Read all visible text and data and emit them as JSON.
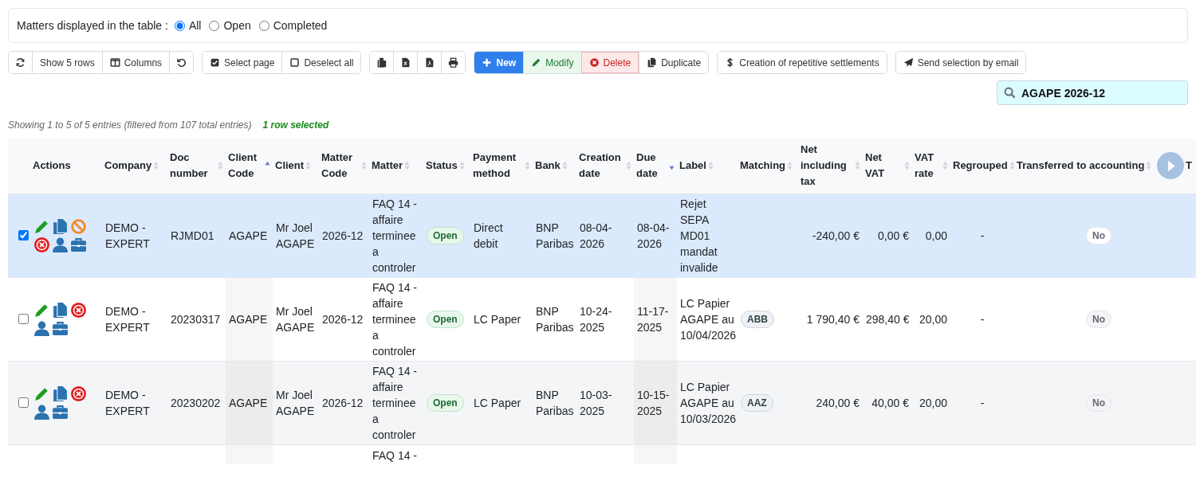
{
  "filter": {
    "label": "Matters displayed in the table :",
    "options": [
      {
        "label": "All",
        "selected": true
      },
      {
        "label": "Open",
        "selected": false
      },
      {
        "label": "Completed",
        "selected": false
      }
    ]
  },
  "toolbar": [
    {
      "buttons": [
        {
          "kind": "icon"
        },
        {
          "label": "Show 5 rows",
          "kind": "plain"
        },
        {
          "label": "Columns",
          "kind": "plain"
        },
        {
          "kind": "icon"
        }
      ]
    },
    {
      "buttons": [
        {
          "label": "Select page",
          "kind": "plain"
        },
        {
          "label": "Deselect all",
          "kind": "plain"
        }
      ]
    },
    {
      "buttons": [
        {
          "kind": "icon"
        },
        {
          "kind": "icon"
        },
        {
          "kind": "icon"
        },
        {
          "kind": "icon"
        }
      ]
    },
    {
      "buttons": [
        {
          "label": "New",
          "kind": "primary"
        },
        {
          "label": "Modify",
          "kind": "success"
        },
        {
          "label": "Delete",
          "kind": "danger"
        },
        {
          "label": "Duplicate",
          "kind": "plain"
        }
      ]
    },
    {
      "buttons": [
        {
          "label": "Creation of repetitive settlements",
          "kind": "plain"
        }
      ]
    },
    {
      "buttons": [
        {
          "label": "Send selection by email",
          "kind": "plain"
        }
      ]
    }
  ],
  "search": {
    "value": "AGAPE 2026-12"
  },
  "info": {
    "text": "Showing 1 to 5 of 5 entries (filtered from 107 total entries)",
    "selection": "1 row selected"
  },
  "table": {
    "columns": [
      {
        "label": "Actions",
        "sortable": false
      },
      {
        "label": "Company",
        "sortable": true,
        "sort_asc": false,
        "sort_desc": false
      },
      {
        "label": "Doc number",
        "sortable": true,
        "sort_asc": false,
        "sort_desc": false
      },
      {
        "label": "Client Code",
        "sortable": true,
        "sort_asc": true,
        "sort_desc": false
      },
      {
        "label": "Client",
        "sortable": true,
        "sort_asc": false,
        "sort_desc": false
      },
      {
        "label": "Matter Code",
        "sortable": true,
        "sort_asc": false,
        "sort_desc": false
      },
      {
        "label": "Matter",
        "sortable": true,
        "sort_asc": false,
        "sort_desc": false
      },
      {
        "label": "Status",
        "sortable": true,
        "sort_asc": false,
        "sort_desc": false
      },
      {
        "label": "Payment method",
        "sortable": true,
        "sort_asc": false,
        "sort_desc": false
      },
      {
        "label": "Bank",
        "sortable": true,
        "sort_asc": false,
        "sort_desc": false
      },
      {
        "label": "Creation date",
        "sortable": true,
        "sort_asc": false,
        "sort_desc": false
      },
      {
        "label": "Due date",
        "sortable": true,
        "sort_asc": false,
        "sort_desc": true
      },
      {
        "label": "Label",
        "sortable": true,
        "sort_asc": false,
        "sort_desc": false
      },
      {
        "label": "Matching",
        "sortable": true,
        "sort_asc": false,
        "sort_desc": false
      },
      {
        "label": "Net including tax",
        "sortable": true,
        "sort_asc": false,
        "sort_desc": false
      },
      {
        "label": "Net VAT",
        "sortable": true,
        "sort_asc": false,
        "sort_desc": false
      },
      {
        "label": "VAT rate",
        "sortable": true,
        "sort_asc": false,
        "sort_desc": false
      },
      {
        "label": "Regrouped",
        "sortable": true,
        "sort_asc": false,
        "sort_desc": false
      },
      {
        "label": "Transferred to accounting",
        "sortable": true,
        "sort_asc": false,
        "sort_desc": false
      },
      {
        "label": "T"
      }
    ],
    "rows": [
      {
        "selected": true,
        "actions": [
          {
            "kind": "edit"
          },
          {
            "kind": "copy"
          },
          {
            "kind": "ban"
          },
          {
            "kind": "delete"
          },
          {
            "kind": "client"
          },
          {
            "kind": "briefcase"
          }
        ],
        "company": "DEMO - EXPERT",
        "doc_number": "RJMD01",
        "client_code": "AGAPE",
        "client": "Mr Joel AGAPE",
        "matter_code": "2026-12",
        "matter": "FAQ 14 - affaire terminee a controler",
        "status": "Open",
        "payment_method": "Direct debit",
        "bank": "BNP Paribas",
        "creation_date": "08-04-2026",
        "due_date": "08-04-2026",
        "label": "Rejet SEPA MD01 mandat invalide",
        "net_including_tax": "-240,00 €",
        "net_vat": "0,00 €",
        "vat_rate": "0,00",
        "regrouped": "-",
        "transferred": "No"
      },
      {
        "selected": false,
        "actions": [
          {
            "kind": "edit"
          },
          {
            "kind": "copy"
          },
          {
            "kind": "delete"
          },
          {
            "kind": "client"
          },
          {
            "kind": "briefcase"
          }
        ],
        "company": "DEMO - EXPERT",
        "doc_number": "20230317",
        "client_code": "AGAPE",
        "client": "Mr Joel AGAPE",
        "matter_code": "2026-12",
        "matter": "FAQ 14 - affaire terminee a controler",
        "status": "Open",
        "payment_method": "LC Paper",
        "bank": "BNP Paribas",
        "creation_date": "10-24-2025",
        "due_date": "11-17-2025",
        "label": "LC Papier AGAPE au 10/04/2026",
        "matching": "ABB",
        "net_including_tax": "1 790,40 €",
        "net_vat": "298,40 €",
        "vat_rate": "20,00",
        "regrouped": "-",
        "transferred": "No"
      },
      {
        "selected": false,
        "actions": [
          {
            "kind": "edit"
          },
          {
            "kind": "copy"
          },
          {
            "kind": "delete"
          },
          {
            "kind": "client"
          },
          {
            "kind": "briefcase"
          }
        ],
        "company": "DEMO - EXPERT",
        "doc_number": "20230202",
        "client_code": "AGAPE",
        "client": "Mr Joel AGAPE",
        "matter_code": "2026-12",
        "matter": "FAQ 14 - affaire terminee a controler",
        "status": "Open",
        "payment_method": "LC Paper",
        "bank": "BNP Paribas",
        "creation_date": "10-03-2025",
        "due_date": "10-15-2025",
        "label": "LC Papier AGAPE au 10/03/2026",
        "matching": "AAZ",
        "net_including_tax": "240,00 €",
        "net_vat": "40,00 €",
        "vat_rate": "20,00",
        "regrouped": "-",
        "transferred": "No"
      },
      {
        "matter": "FAQ 14 -"
      }
    ]
  }
}
